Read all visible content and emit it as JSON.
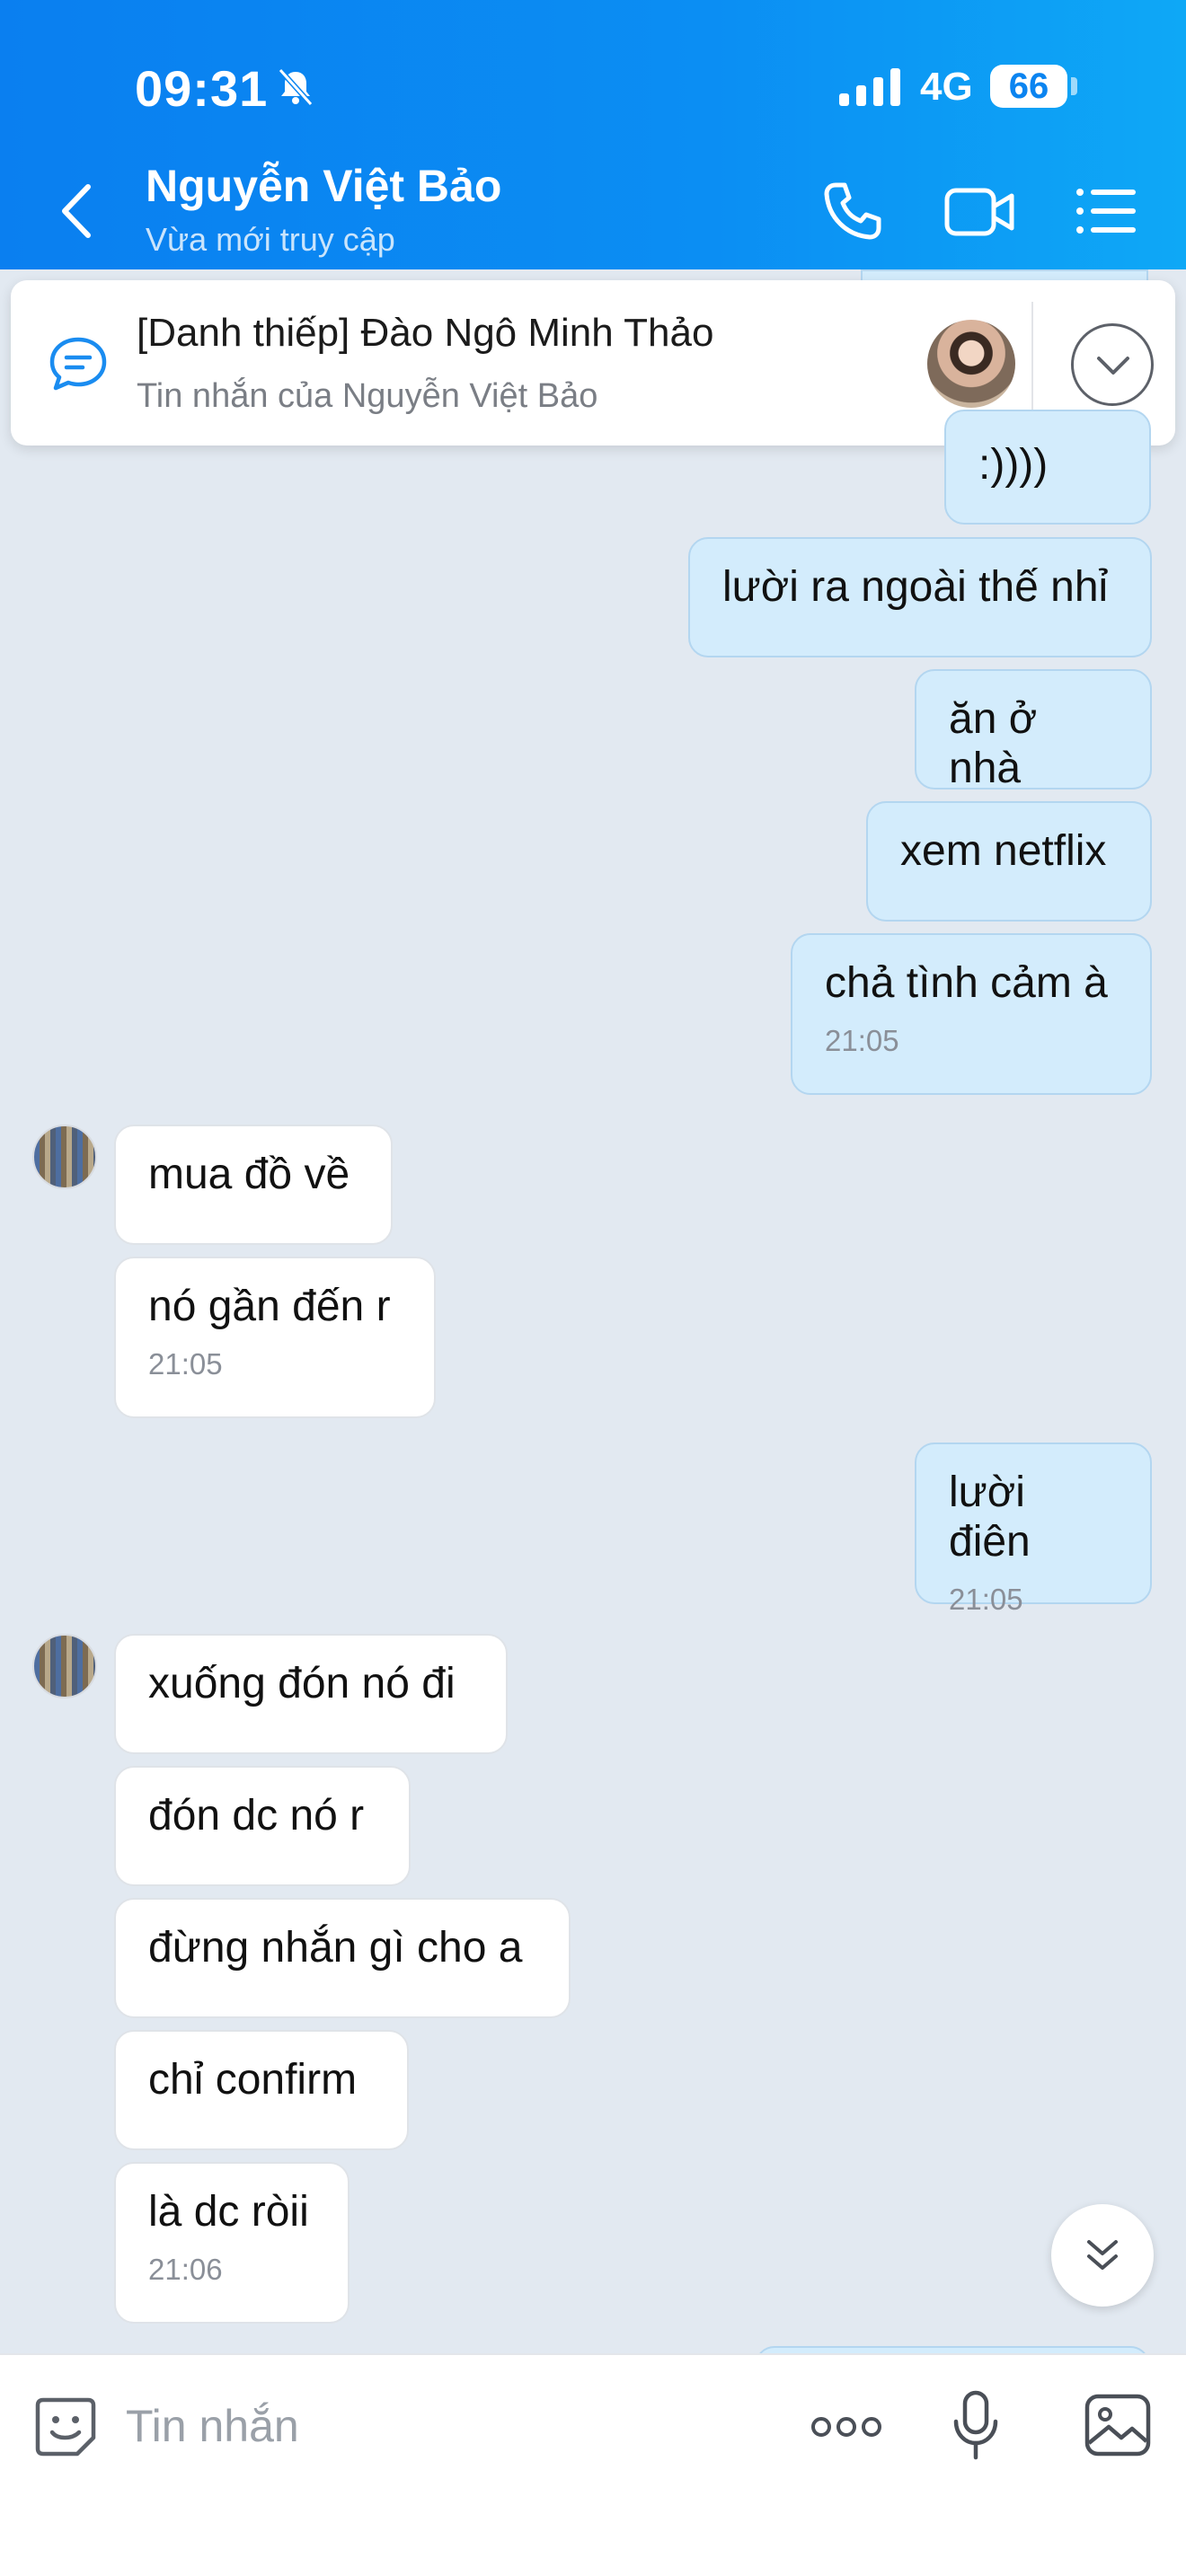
{
  "status_bar": {
    "time": "09:31",
    "network": "4G",
    "battery": "66"
  },
  "header": {
    "contact_name": "Nguyễn Việt Bảo",
    "contact_status": "Vừa mới truy cập"
  },
  "pinned": {
    "title": "[Danh thiếp] Đào Ngô Minh Thảo",
    "subtitle": "Tin nhắn của Nguyễn Việt Bảo"
  },
  "messages": [
    {
      "from": "me",
      "text": ":))))",
      "time": ""
    },
    {
      "from": "me",
      "text": "lười ra ngoài thế nhỉ",
      "time": ""
    },
    {
      "from": "me",
      "text": "ăn ở nhà",
      "time": ""
    },
    {
      "from": "me",
      "text": "xem netflix",
      "time": ""
    },
    {
      "from": "me",
      "text": "chả tình cảm à",
      "time": "21:05"
    },
    {
      "from": "them",
      "text": "mua đồ về",
      "time": ""
    },
    {
      "from": "them",
      "text": "nó gần đến r",
      "time": "21:05"
    },
    {
      "from": "me",
      "text": "lười điên",
      "time": "21:05"
    },
    {
      "from": "them",
      "text": "xuống đón nó đi",
      "time": ""
    },
    {
      "from": "them",
      "text": "đón dc nó r",
      "time": ""
    },
    {
      "from": "them",
      "text": "đừng nhắn gì cho a",
      "time": ""
    },
    {
      "from": "them",
      "text": "chỉ confirm",
      "time": ""
    },
    {
      "from": "them",
      "text": "là dc ròii",
      "time": "21:06"
    }
  ],
  "input": {
    "placeholder": "Tin nhắn"
  },
  "colors": {
    "header": "#0b8ef3",
    "my_bubble": "#d3ecfc",
    "their_bubble": "#ffffff",
    "background": "#e2e9f1"
  }
}
